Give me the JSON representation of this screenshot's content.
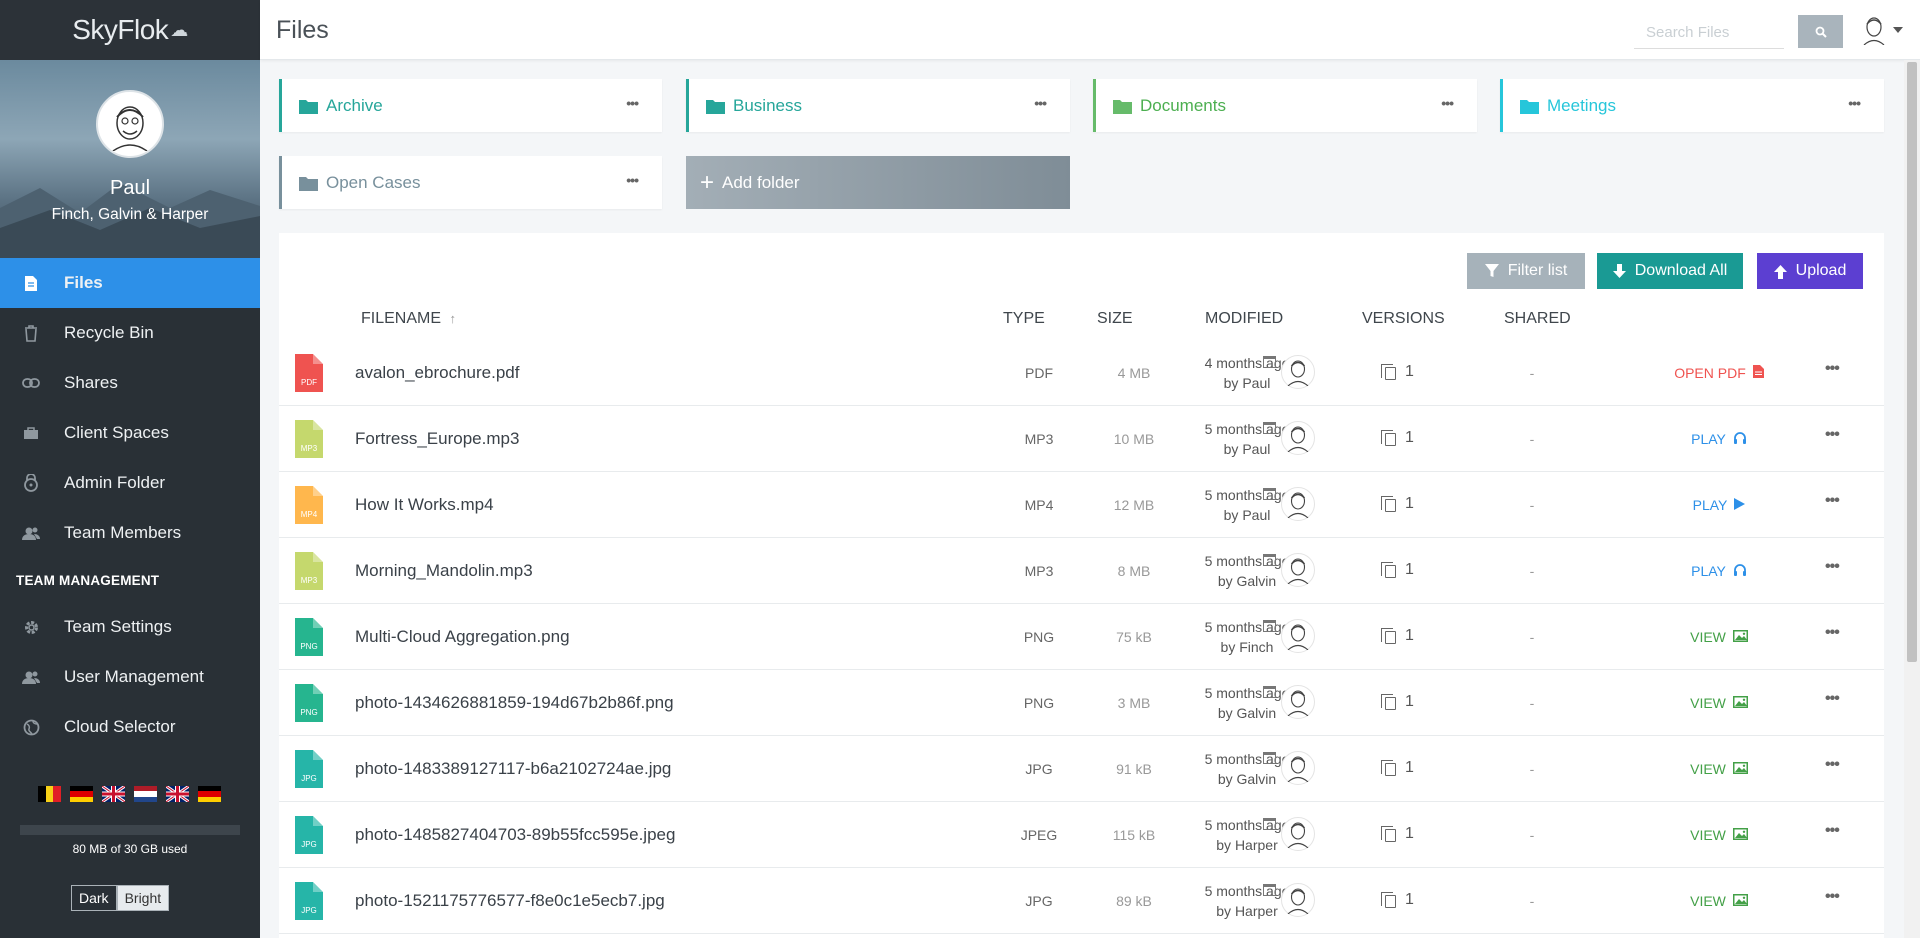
{
  "app": {
    "name": "SkyFlok"
  },
  "profile": {
    "name": "Paul",
    "team": "Finch, Galvin & Harper"
  },
  "nav": {
    "items": [
      {
        "label": "Files",
        "icon": "file-icon"
      },
      {
        "label": "Recycle Bin",
        "icon": "trash-icon"
      },
      {
        "label": "Shares",
        "icon": "link-icon"
      },
      {
        "label": "Client Spaces",
        "icon": "briefcase-icon"
      },
      {
        "label": "Admin Folder",
        "icon": "lock-icon"
      },
      {
        "label": "Team Members",
        "icon": "users-icon"
      }
    ],
    "section_title": "TEAM MANAGEMENT",
    "mgmt_items": [
      {
        "label": "Team Settings",
        "icon": "gear-icon"
      },
      {
        "label": "User Management",
        "icon": "users-icon"
      },
      {
        "label": "Cloud Selector",
        "icon": "globe-icon"
      }
    ]
  },
  "flags": [
    "be",
    "de",
    "gb",
    "nl",
    "gb",
    "de"
  ],
  "storage": {
    "text": "80 MB of 30 GB used",
    "used_fraction": 0.003
  },
  "theme": {
    "dark_label": "Dark",
    "bright_label": "Bright"
  },
  "header": {
    "title": "Files",
    "search_placeholder": "Search Files"
  },
  "folders": [
    {
      "name": "Archive",
      "color": "#26a69a",
      "text_color": "#26a69a"
    },
    {
      "name": "Business",
      "color": "#26a69a",
      "text_color": "#26a69a"
    },
    {
      "name": "Documents",
      "color": "#66bb6a",
      "text_color": "#4caf50"
    },
    {
      "name": "Meetings",
      "color": "#26c6da",
      "text_color": "#26c6da"
    },
    {
      "name": "Open Cases",
      "color": "#78909c",
      "text_color": "#78909c"
    }
  ],
  "add_folder_label": "Add folder",
  "actions": {
    "filter": "Filter list",
    "download_all": "Download All",
    "upload": "Upload"
  },
  "columns": {
    "filename": "FILENAME",
    "type": "TYPE",
    "size": "SIZE",
    "modified": "MODIFIED",
    "versions": "VERSIONS",
    "shared": "SHARED"
  },
  "files": [
    {
      "name": "avalon_ebrochure.pdf",
      "badge": "PDF",
      "badge_color": "#ef5350",
      "type": "PDF",
      "size": "4 MB",
      "modified": "4 months ago",
      "by": "by Paul",
      "versions": "1",
      "shared": "-",
      "action": "OPEN PDF",
      "action_color": "#ef5350",
      "action_icon": "pdf-icon"
    },
    {
      "name": "Fortress_Europe.mp3",
      "badge": "MP3",
      "badge_color": "#c5d86d",
      "type": "MP3",
      "size": "10 MB",
      "modified": "5 months ago",
      "by": "by Paul",
      "versions": "1",
      "shared": "-",
      "action": "PLAY",
      "action_color": "#2d90e8",
      "action_icon": "headphones-icon"
    },
    {
      "name": "How It Works.mp4",
      "badge": "MP4",
      "badge_color": "#ffb74d",
      "type": "MP4",
      "size": "12 MB",
      "modified": "5 months ago",
      "by": "by Paul",
      "versions": "1",
      "shared": "-",
      "action": "PLAY",
      "action_color": "#2d90e8",
      "action_icon": "play-icon"
    },
    {
      "name": "Morning_Mandolin.mp3",
      "badge": "MP3",
      "badge_color": "#c5d86d",
      "type": "MP3",
      "size": "8 MB",
      "modified": "5 months ago",
      "by": "by Galvin",
      "versions": "1",
      "shared": "-",
      "action": "PLAY",
      "action_color": "#2d90e8",
      "action_icon": "headphones-icon"
    },
    {
      "name": "Multi-Cloud Aggregation.png",
      "badge": "PNG",
      "badge_color": "#26b58f",
      "type": "PNG",
      "size": "75 kB",
      "modified": "5 months ago",
      "by": "by Finch",
      "versions": "1",
      "shared": "-",
      "action": "VIEW",
      "action_color": "#43a047",
      "action_icon": "image-icon"
    },
    {
      "name": "photo-1434626881859-194d67b2b86f.png",
      "badge": "PNG",
      "badge_color": "#26b58f",
      "type": "PNG",
      "size": "3 MB",
      "modified": "5 months ago",
      "by": "by Galvin",
      "versions": "1",
      "shared": "-",
      "action": "VIEW",
      "action_color": "#43a047",
      "action_icon": "image-icon"
    },
    {
      "name": "photo-1483389127117-b6a2102724ae.jpg",
      "badge": "JPG",
      "badge_color": "#26b5a8",
      "type": "JPG",
      "size": "91 kB",
      "modified": "5 months ago",
      "by": "by Galvin",
      "versions": "1",
      "shared": "-",
      "action": "VIEW",
      "action_color": "#43a047",
      "action_icon": "image-icon"
    },
    {
      "name": "photo-1485827404703-89b55fcc595e.jpeg",
      "badge": "JPG",
      "badge_color": "#26b5a8",
      "type": "JPEG",
      "size": "115 kB",
      "modified": "5 months ago",
      "by": "by Harper",
      "versions": "1",
      "shared": "-",
      "action": "VIEW",
      "action_color": "#43a047",
      "action_icon": "image-icon"
    },
    {
      "name": "photo-1521175776577-f8e0c1e5ecb7.jpg",
      "badge": "JPG",
      "badge_color": "#26b5a8",
      "type": "JPG",
      "size": "89 kB",
      "modified": "5 months ago",
      "by": "by Harper",
      "versions": "1",
      "shared": "-",
      "action": "VIEW",
      "action_color": "#43a047",
      "action_icon": "image-icon"
    }
  ]
}
